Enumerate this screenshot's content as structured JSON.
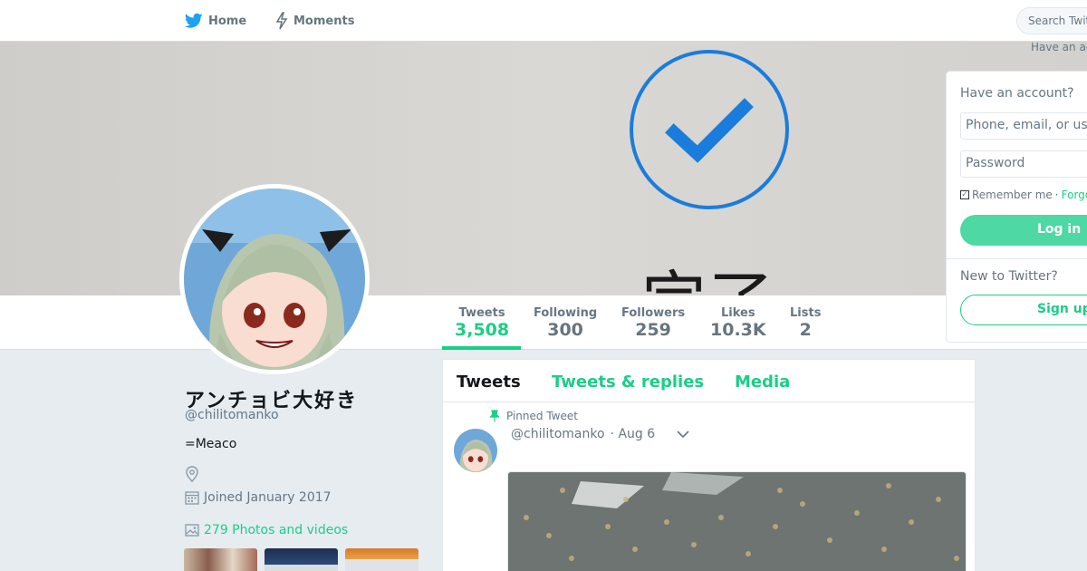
{
  "nav": {
    "home_label": "Home",
    "moments_label": "Moments",
    "search_placeholder": "Search Twitter",
    "have_account_hint": "Have an account?"
  },
  "banner": {
    "kanji_text": "完了"
  },
  "stats": [
    {
      "label": "Tweets",
      "value": "3,508"
    },
    {
      "label": "Following",
      "value": "300"
    },
    {
      "label": "Followers",
      "value": "259"
    },
    {
      "label": "Likes",
      "value": "10.3K"
    },
    {
      "label": "Lists",
      "value": "2"
    }
  ],
  "profile": {
    "name": "アンチョビ大好き",
    "handle": "@chilitomanko",
    "bio": "=Meaco",
    "joined": "Joined January 2017",
    "photos_label": "279 Photos and videos"
  },
  "timeline": {
    "tabs": [
      "Tweets",
      "Tweets & replies",
      "Media"
    ],
    "pinned_label": "Pinned Tweet",
    "tweet": {
      "handle": "@chilitomanko",
      "date": "· Aug 6"
    }
  },
  "login": {
    "title": "Have an account?",
    "username_placeholder": "Phone, email, or username",
    "password_placeholder": "Password",
    "remember_label": "Remember me",
    "separator": "·",
    "forgot_label": "Forgot password?",
    "login_button": "Log in",
    "new_label": "New to Twitter?",
    "signup_button": "Sign up"
  },
  "colors": {
    "accent": "#19cf86",
    "login_button": "#4ed8a4",
    "muted_text": "#657786",
    "background": "#e6ecf0",
    "verified_blue": "#1a7ddb"
  }
}
